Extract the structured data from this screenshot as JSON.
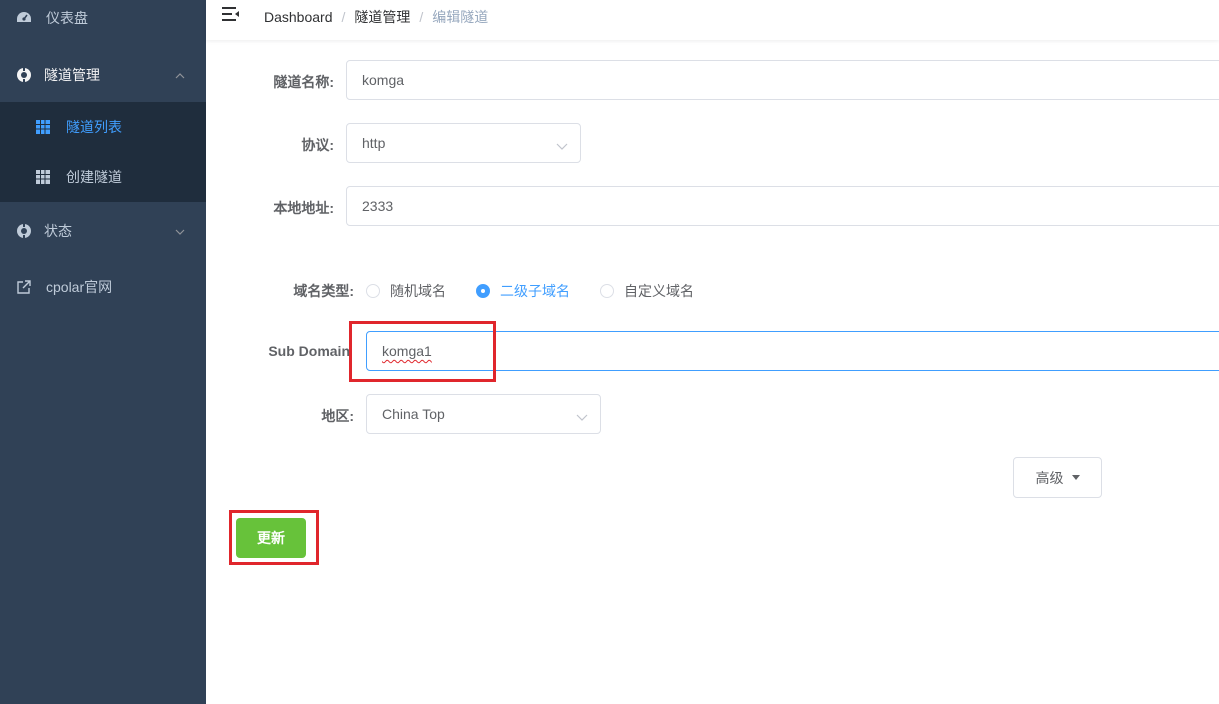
{
  "sidebar": {
    "items": [
      {
        "label": "仪表盘",
        "icon": "dashboard-icon"
      },
      {
        "label": "隧道管理",
        "icon": "tunnel-icon",
        "expanded": true,
        "children": [
          {
            "label": "隧道列表",
            "icon": "table-icon",
            "active": true
          },
          {
            "label": "创建隧道",
            "icon": "table-icon"
          }
        ]
      },
      {
        "label": "状态",
        "icon": "status-icon"
      },
      {
        "label": "cpolar官网",
        "icon": "external-link-icon"
      }
    ]
  },
  "breadcrumb": [
    "Dashboard",
    "隧道管理",
    "编辑隧道"
  ],
  "form": {
    "tunnel_name_label": "隧道名称:",
    "tunnel_name_value": "komga",
    "protocol_label": "协议:",
    "protocol_value": "http",
    "local_addr_label": "本地地址:",
    "local_addr_value": "2333",
    "domain_type_label": "域名类型:",
    "domain_type_options": [
      "随机域名",
      "二级子域名",
      "自定义域名"
    ],
    "domain_type_selected": "二级子域名",
    "subdomain_label": "Sub Domain",
    "subdomain_value": "komga1",
    "region_label": "地区:",
    "region_value": "China Top",
    "advanced_label": "高级",
    "update_label": "更新"
  },
  "colors": {
    "sidebar_bg": "#304156",
    "submenu_bg": "#1f2d3d",
    "accent": "#409eff",
    "success": "#67c23a",
    "highlight": "#e0262c"
  }
}
